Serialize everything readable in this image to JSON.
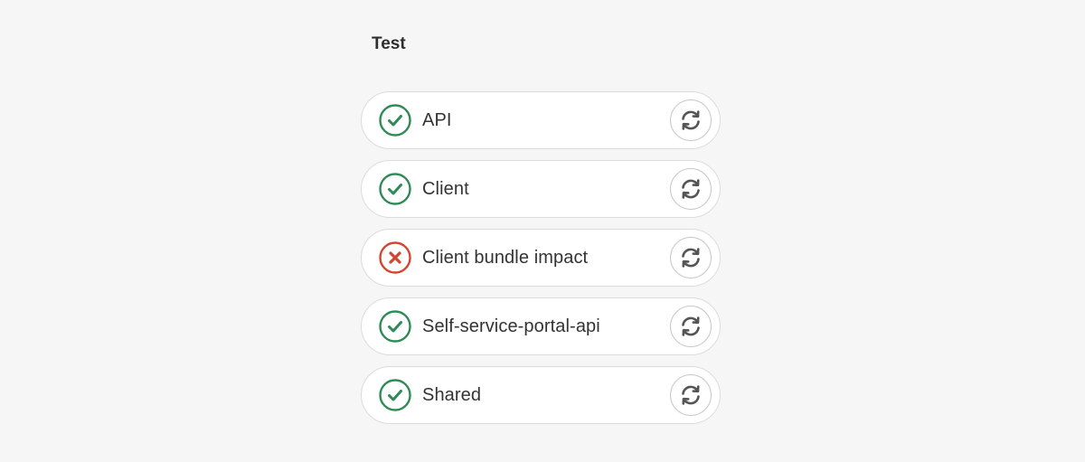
{
  "stage": {
    "title": "Test"
  },
  "jobs": [
    {
      "name": "API",
      "status": "success",
      "status_icon": "check-circle-icon",
      "action_icon": "retry-icon"
    },
    {
      "name": "Client",
      "status": "success",
      "status_icon": "check-circle-icon",
      "action_icon": "retry-icon"
    },
    {
      "name": "Client bundle impact",
      "status": "failed",
      "status_icon": "x-circle-icon",
      "action_icon": "retry-icon"
    },
    {
      "name": "Self-service-portal-api",
      "status": "success",
      "status_icon": "check-circle-icon",
      "action_icon": "retry-icon"
    },
    {
      "name": "Shared",
      "status": "success",
      "status_icon": "check-circle-icon",
      "action_icon": "retry-icon"
    }
  ],
  "colors": {
    "success": "#2e8b57",
    "failed": "#d2452f",
    "icon_gray": "#555555",
    "background": "#f6f6f6"
  }
}
